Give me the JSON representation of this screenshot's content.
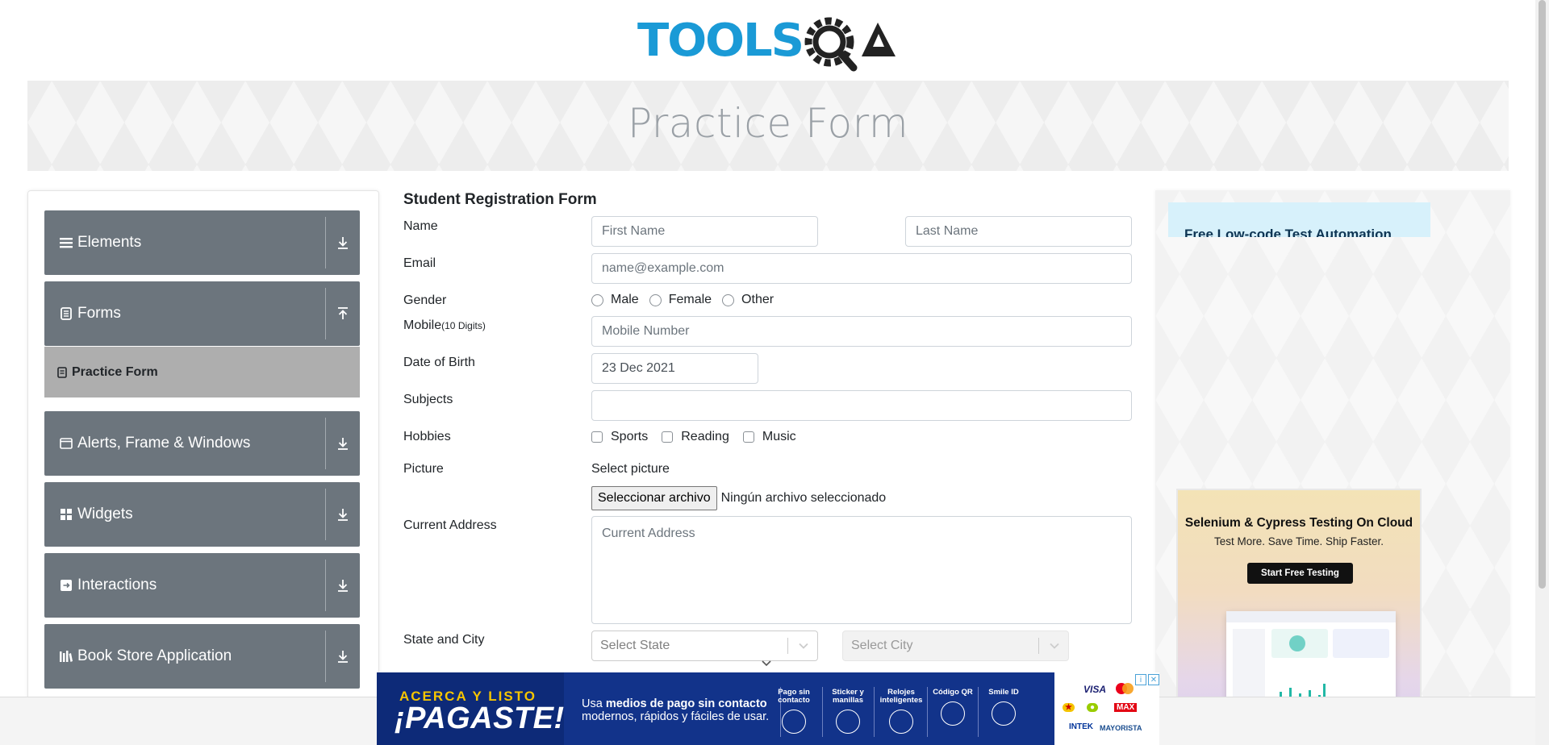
{
  "header": {
    "logo_text": "TOOLSQA"
  },
  "banner": {
    "title": "Practice Form"
  },
  "sidebar": {
    "groups": [
      {
        "label": "Elements",
        "icon": "list-icon"
      },
      {
        "label": "Forms",
        "icon": "document-icon"
      },
      {
        "label": "Alerts, Frame & Windows",
        "icon": "window-icon"
      },
      {
        "label": "Widgets",
        "icon": "grid-icon"
      },
      {
        "label": "Interactions",
        "icon": "interaction-icon"
      },
      {
        "label": "Book Store Application",
        "icon": "books-icon"
      }
    ],
    "active_item": "Practice Form"
  },
  "form": {
    "title": "Student Registration Form",
    "labels": {
      "name": "Name",
      "email": "Email",
      "gender": "Gender",
      "mobile": "Mobile",
      "mobile_hint": "(10 Digits)",
      "dob": "Date of Birth",
      "subjects": "Subjects",
      "hobbies": "Hobbies",
      "picture": "Picture",
      "address": "Current Address",
      "state_city": "State and City"
    },
    "placeholders": {
      "first_name": "First Name",
      "last_name": "Last Name",
      "email": "name@example.com",
      "mobile": "Mobile Number",
      "address": "Current Address",
      "state": "Select State",
      "city": "Select City"
    },
    "dob_value": "23 Dec 2021",
    "genders": [
      "Male",
      "Female",
      "Other"
    ],
    "hobbies": [
      "Sports",
      "Reading",
      "Music"
    ],
    "picture_prompt": "Select picture",
    "file_button": "Seleccionar archivo",
    "file_status": "Ningún archivo seleccionado"
  },
  "ads": {
    "top_headline": "Free Low-code Test Automation",
    "card": {
      "title": "Selenium & Cypress Testing On Cloud",
      "subtitle": "Test More. Save Time. Ship Faster.",
      "cta": "Start Free Testing"
    },
    "bottom": {
      "kicker": "ACERCA Y LISTO",
      "headline": "¡PAGASTE!",
      "copy_prefix": "Usa ",
      "copy_bold": "medios de pago sin contacto",
      "copy_line2": "modernos, rápidos y fáciles de usar.",
      "features": [
        "Pago sin contacto",
        "Sticker y manillas",
        "Relojes inteligentes",
        "Código QR",
        "Smile ID"
      ],
      "brands": [
        "VISA",
        "MAX",
        "INTEK",
        "MAYORISTA"
      ]
    }
  },
  "colors": {
    "menu_bg": "#6c757d",
    "menu_active_bg": "#aeaeae",
    "logo_blue": "#1a9ad6",
    "logo_dark": "#222"
  }
}
